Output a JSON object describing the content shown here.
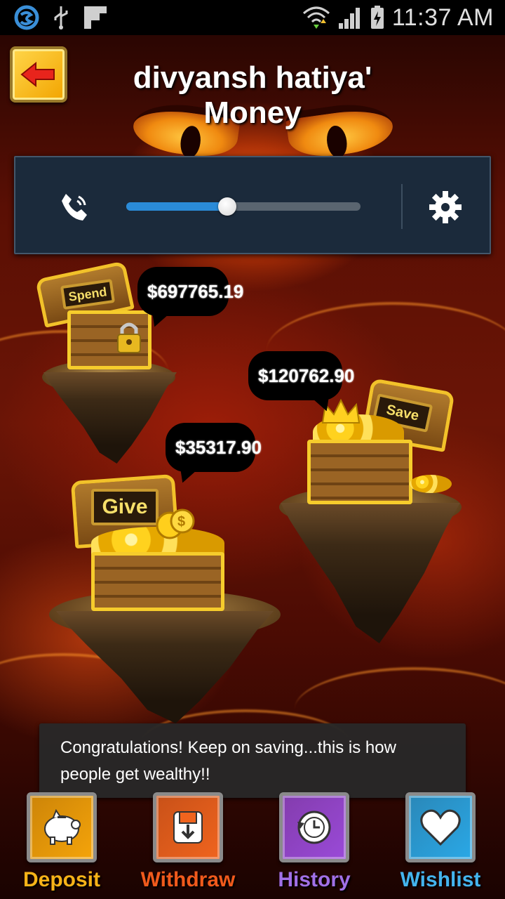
{
  "status_bar": {
    "time": "11:37 AM",
    "icons": [
      "skype-icon",
      "usb-icon",
      "flipboard-icon",
      "wifi-icon",
      "signal-icon",
      "battery-charging-icon"
    ]
  },
  "header": {
    "title": "divyansh hatiya' Money",
    "back_icon": "back-arrow-icon"
  },
  "volume_panel": {
    "left_icon": "phone-volume-icon",
    "level": 0.43,
    "right_icon": "gear-icon"
  },
  "jars": [
    {
      "id": "spend",
      "sign": "Spend",
      "amount": "$697765.19"
    },
    {
      "id": "save",
      "sign": "Save",
      "amount": "$120762.90"
    },
    {
      "id": "give",
      "sign": "Give",
      "amount": "$35317.90"
    }
  ],
  "toast": {
    "message": "Congratulations! Keep on saving...this is how people get wealthy!!"
  },
  "bottom_nav": [
    {
      "id": "deposit",
      "label": "Deposit",
      "icon": "piggy-bank-icon",
      "color": "#f5a40a",
      "label_color": "#f7b318"
    },
    {
      "id": "withdraw",
      "label": "Withdraw",
      "icon": "withdraw-box-icon",
      "color": "#f0641e",
      "label_color": "#f05a1c"
    },
    {
      "id": "history",
      "label": "History",
      "icon": "history-clock-icon",
      "color": "#9a4ad8",
      "label_color": "#a070e6"
    },
    {
      "id": "wishlist",
      "label": "Wishlist",
      "icon": "heart-icon",
      "color": "#2aa8e6",
      "label_color": "#44b4ee"
    }
  ]
}
